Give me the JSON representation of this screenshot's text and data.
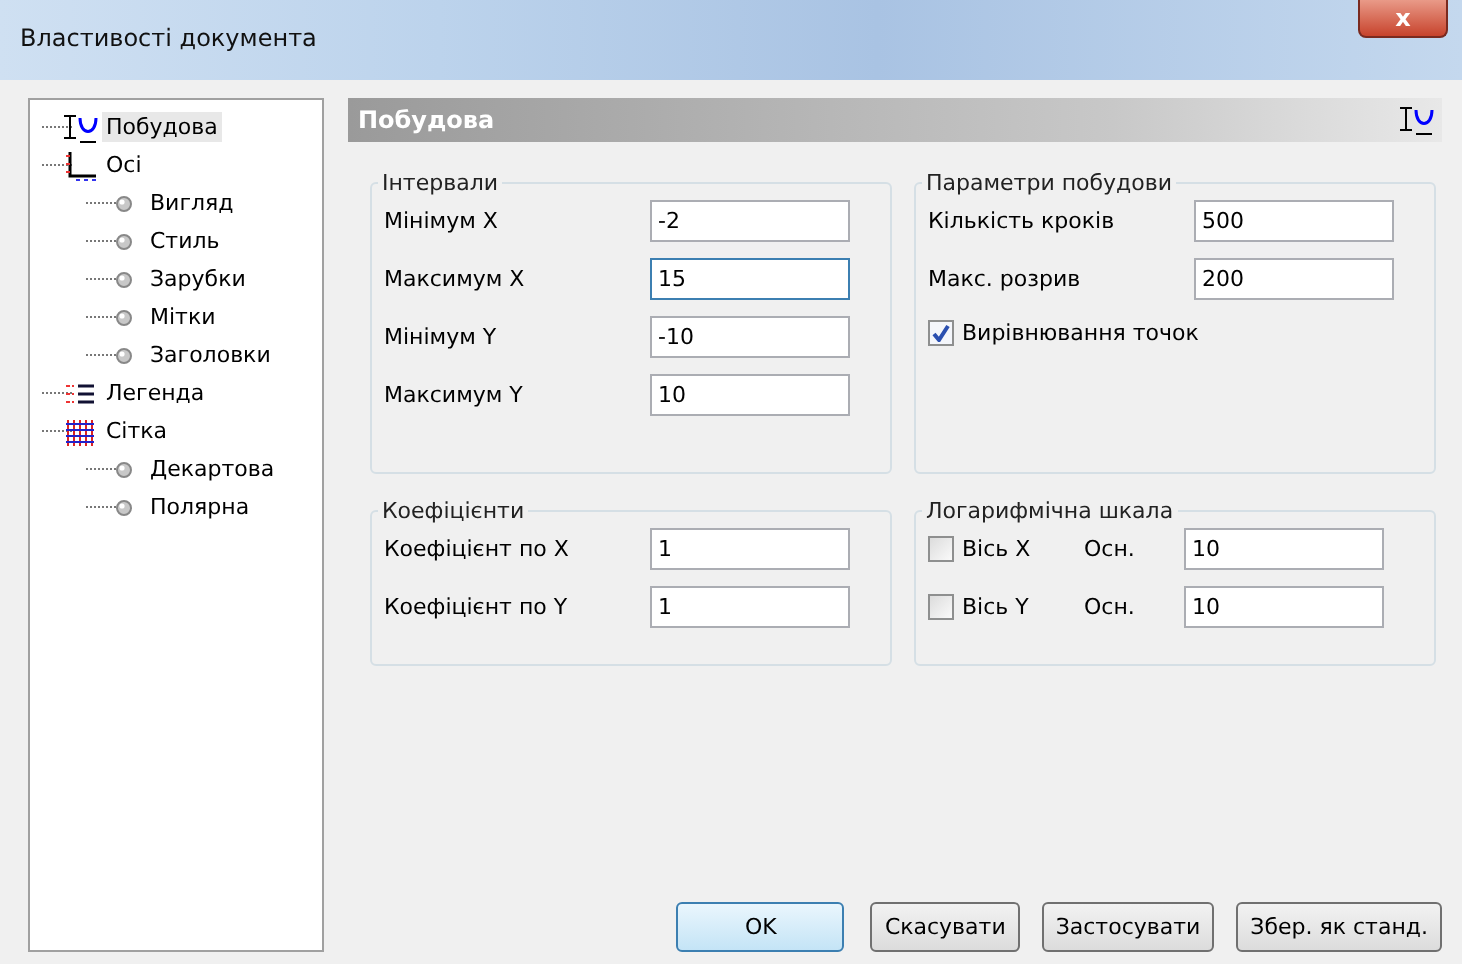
{
  "window": {
    "title": "Властивості документа",
    "close": "x"
  },
  "tree": [
    {
      "label": "Побудова",
      "kind": "curve",
      "selected": true
    },
    {
      "label": "Осі",
      "kind": "axes",
      "selected": false,
      "children": [
        {
          "label": "Вигляд",
          "kind": "leaf",
          "selected": false
        },
        {
          "label": "Стиль",
          "kind": "leaf",
          "selected": false
        },
        {
          "label": "Зарубки",
          "kind": "leaf",
          "selected": false
        },
        {
          "label": "Мітки",
          "kind": "leaf",
          "selected": false
        },
        {
          "label": "Заголовки",
          "kind": "leaf",
          "selected": false
        }
      ]
    },
    {
      "label": "Легенда",
      "kind": "legend",
      "selected": false
    },
    {
      "label": "Сітка",
      "kind": "grid",
      "selected": false,
      "children": [
        {
          "label": "Декартова",
          "kind": "leaf",
          "selected": false
        },
        {
          "label": "Полярна",
          "kind": "leaf",
          "selected": false
        }
      ]
    }
  ],
  "header": {
    "title": "Побудова"
  },
  "groups": [
    {
      "title": "Інтервали",
      "rows": [
        {
          "kind": "field",
          "label": "Мінімум X",
          "value": "-2",
          "focused": false
        },
        {
          "kind": "field",
          "label": "Максимум X",
          "value": "15",
          "focused": true
        },
        {
          "kind": "field",
          "label": "Мінімум Y",
          "value": "-10",
          "focused": false
        },
        {
          "kind": "field",
          "label": "Максимум Y",
          "value": "10",
          "focused": false
        }
      ]
    },
    {
      "title": "Параметри побудови",
      "rows": [
        {
          "kind": "field",
          "label": "Кількість кроків",
          "value": "500",
          "focused": false
        },
        {
          "kind": "field",
          "label": "Макс. розрив",
          "value": "200",
          "focused": false
        },
        {
          "kind": "check",
          "label": "Вирівнювання точок",
          "checked": true
        }
      ]
    },
    {
      "title": "Коефіцієнти",
      "rows": [
        {
          "kind": "field",
          "label": "Коефіцієнт по X",
          "value": "1",
          "focused": false
        },
        {
          "kind": "field",
          "label": "Коефіцієнт по Y",
          "value": "1",
          "focused": false
        }
      ]
    },
    {
      "title": "Логарифмічна шкала",
      "rows": [
        {
          "kind": "checkfield",
          "label": "Вісь X",
          "checked": false,
          "sublabel": "Осн.",
          "value": "10"
        },
        {
          "kind": "checkfield",
          "label": "Вісь Y",
          "checked": false,
          "sublabel": "Осн.",
          "value": "10"
        }
      ]
    }
  ],
  "buttons": [
    {
      "label": "OK",
      "default": true
    },
    {
      "label": "Скасувати",
      "default": false
    },
    {
      "label": "Застосувати",
      "default": false
    },
    {
      "label": "Збер. як станд.",
      "default": false
    }
  ]
}
